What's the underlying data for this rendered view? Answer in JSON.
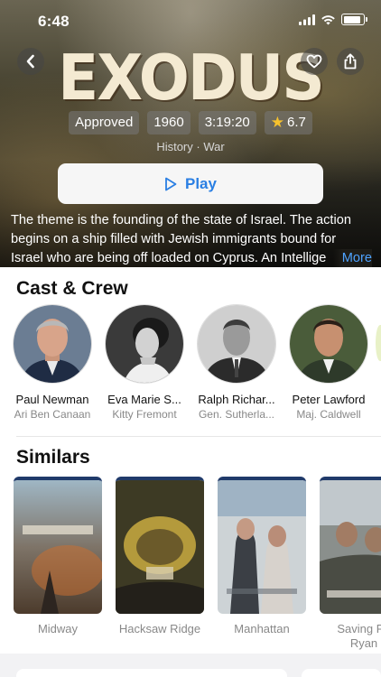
{
  "status_bar": {
    "time": "6:48"
  },
  "movie": {
    "title": "EXODUS",
    "badges": {
      "rating": "Approved",
      "year": "1960",
      "duration": "3:19:20",
      "score": "6.7"
    },
    "genres": "History · War",
    "play_label": "Play",
    "description_lines": [
      "The theme is the founding of the state of Israel. The action",
      "begins on a ship filled with Jewish immigrants bound for",
      "Israel who are being off loaded on Cyprus. An Intellige"
    ],
    "more_label": "More"
  },
  "cast_section": {
    "title": "Cast & Crew",
    "members": [
      {
        "name": "Paul Newman",
        "role": "Ari Ben Canaan"
      },
      {
        "name": "Eva Marie S...",
        "role": "Kitty Fremont"
      },
      {
        "name": "Ralph Richar...",
        "role": "Gen. Sutherla..."
      },
      {
        "name": "Peter Lawford",
        "role": "Maj. Caldwell"
      }
    ]
  },
  "similars_section": {
    "title": "Similars",
    "items": [
      {
        "title": "Midway"
      },
      {
        "title": "Hacksaw Ridge"
      },
      {
        "title": "Manhattan"
      },
      {
        "title": "Saving Pri\nRyan"
      }
    ]
  },
  "colors": {
    "accent": "#2a7fe3",
    "more_link": "#4ea2ff",
    "star": "#f7c22d"
  }
}
